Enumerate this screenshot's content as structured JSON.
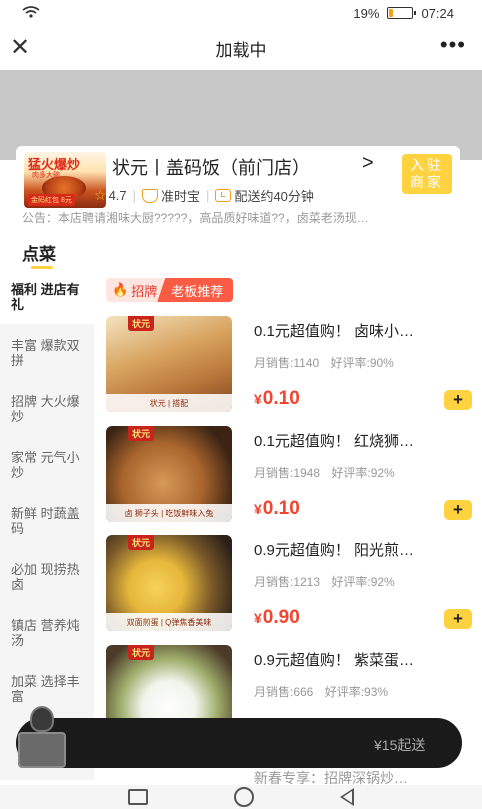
{
  "status_bar": {
    "battery": "19%",
    "battery_level": 0.19,
    "time": "07:24"
  },
  "nav": {
    "title": "加载中"
  },
  "shop": {
    "logo_text": "猛火爆炒",
    "logo_sub": "肉多大碗",
    "logo_tag": "金码红包 8元",
    "name": "状元丨盖码饭（前门店）",
    "arrow": ">",
    "enter_label": "入驻商家",
    "rating": "4.7",
    "on_time": "准时宝",
    "delivery": "配送约40分钟",
    "notice": "公告：本店聘请湘味大厨?????，高品质好味道??，卤菜老汤现…"
  },
  "tabs": {
    "order": "点菜"
  },
  "sidebar": {
    "items": [
      {
        "label": "福利 进店有礼",
        "active": true
      },
      {
        "label": "丰富 爆款双拼"
      },
      {
        "label": "招牌 大火爆炒"
      },
      {
        "label": "家常 元气小炒"
      },
      {
        "label": "新鲜 时蔬盖码"
      },
      {
        "label": "必加 现捞热卤"
      },
      {
        "label": "镇店 营养炖汤"
      },
      {
        "label": "加菜 选择丰富"
      }
    ]
  },
  "section": {
    "tag_left": "招牌",
    "tag_right": "老板推荐"
  },
  "products": [
    {
      "title": "0.1元超值购！ 卤味小…",
      "monthly_sales": "月销售:1140",
      "rating": "好评率:90%",
      "currency": "¥",
      "price": "0.10",
      "brand": "状元",
      "caption": "状元 | 搭配"
    },
    {
      "title": "0.1元超值购！ 红烧狮…",
      "monthly_sales": "月销售:1948",
      "rating": "好评率:92%",
      "currency": "¥",
      "price": "0.10",
      "brand": "状元",
      "caption": "卤 狮子头 | 吃饭鲜味入兔"
    },
    {
      "title": "0.9元超值购！ 阳光煎…",
      "monthly_sales": "月销售:1213",
      "rating": "好评率:92%",
      "currency": "¥",
      "price": "0.90",
      "brand": "状元",
      "caption": "双面煎蛋 | Q弹焦香美味"
    },
    {
      "title": "0.9元超值购！ 紫菜蛋…",
      "monthly_sales": "月销售:666",
      "rating": "好评率:93%",
      "currency": "¥",
      "price": "",
      "brand": "状元",
      "caption": ""
    }
  ],
  "cart": {
    "min_order": "¥15起送"
  },
  "peek_text": "新春专享：招牌深锅炒…",
  "colors": {
    "accent": "#ffd23f",
    "price": "#f2442f",
    "tag": "#fa5b45"
  },
  "icons": [
    "close-icon",
    "more-icon",
    "star-icon",
    "shield-icon",
    "clock-icon",
    "fire-icon",
    "plus-icon",
    "cart-icon"
  ]
}
